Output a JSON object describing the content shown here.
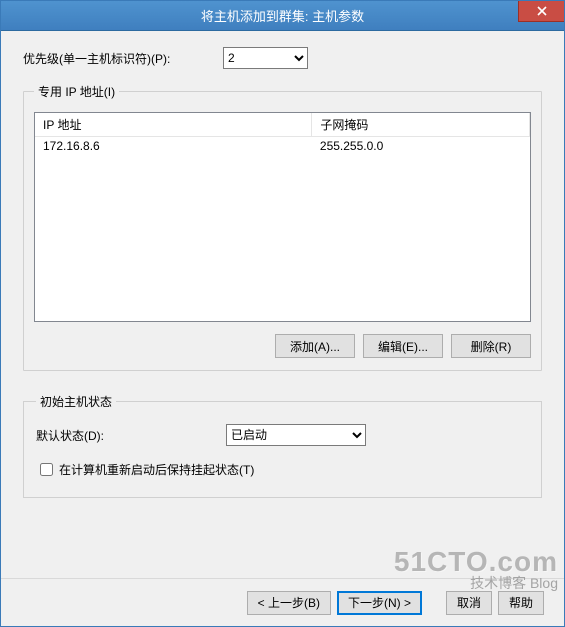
{
  "window": {
    "title": "将主机添加到群集: 主机参数"
  },
  "priority": {
    "label": "优先级(单一主机标识符)(P):",
    "value": "2"
  },
  "ip_group": {
    "legend": "专用 IP 地址(I)",
    "columns": {
      "addr": "IP 地址",
      "mask": "子网掩码"
    },
    "rows": [
      {
        "addr": "172.16.8.6",
        "mask": "255.255.0.0"
      }
    ],
    "buttons": {
      "add": "添加(A)...",
      "edit": "编辑(E)...",
      "remove": "删除(R)"
    }
  },
  "init_state": {
    "legend": "初始主机状态",
    "default_label": "默认状态(D):",
    "default_value": "已启动",
    "retain_label": "在计算机重新启动后保持挂起状态(T)"
  },
  "wizard": {
    "back": "< 上一步(B)",
    "next": "下一步(N) >",
    "cancel": "取消",
    "help": "帮助"
  },
  "watermark": {
    "line1": "51CTO.com",
    "line2": "技术博客 Blog"
  }
}
